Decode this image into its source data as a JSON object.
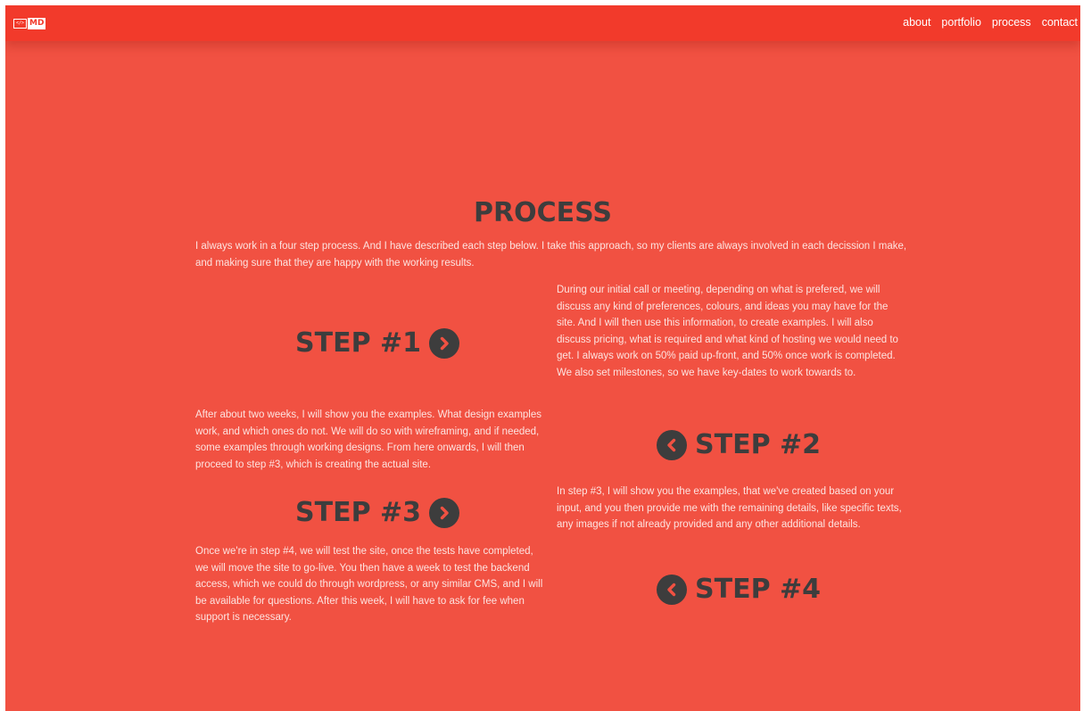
{
  "header": {
    "logo_code": "</>",
    "logo_text": "MD",
    "nav": [
      "about",
      "portfolio",
      "process",
      "contact"
    ]
  },
  "process": {
    "title": "PROCESS",
    "intro": "I always work in a four step process. And I have described each step below. I take this approach, so my clients are always involved in each decission I make, and making sure that they are happy with the working results.",
    "steps": [
      {
        "label": "STEP #1",
        "icon": "chevron-right-circle-icon",
        "text": "During our initial call or meeting, depending on what is prefered, we will discuss any kind of preferences, colours, and ideas you may have for the site. And I will then use this information, to create examples. I will also discuss pricing, what is required and what kind of hosting we would need to get. I always work on 50% paid up-front, and 50% once work is completed. We also set milestones, so we have key-dates to work towards to."
      },
      {
        "label": "STEP #2",
        "icon": "chevron-left-circle-icon",
        "text": "After about two weeks, I will show you the examples. What design examples work, and which ones do not. We will do so with wireframing, and if needed, some examples through working designs. From here onwards, I will then proceed to step #3, which is creating the actual site."
      },
      {
        "label": "STEP #3",
        "icon": "chevron-right-circle-icon",
        "text": "In step #3, I will show you the examples, that we've created based on your input, and you then provide me with the remaining details, like specific texts, any images if not already provided and any other additional details."
      },
      {
        "label": "STEP #4",
        "icon": "chevron-left-circle-icon",
        "text": "Once we're in step #4, we will test the site, once the tests have completed, we will move the site to go-live. You then have a week to test the backend access, which we could do through wordpress, or any similar CMS, and I will be available for questions. After this week, I will have to ask for fee when support is necessary."
      }
    ]
  },
  "colors": {
    "background": "#f15142",
    "navbar": "#f23a2b",
    "heading": "#3d3d3d",
    "text": "#fde3e0"
  }
}
